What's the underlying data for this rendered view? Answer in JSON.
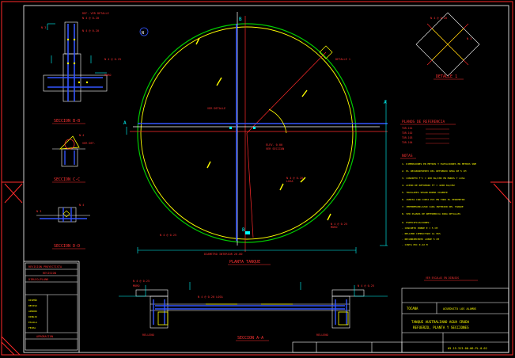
{
  "colors": {
    "background": "#000000",
    "border": "#ff2a2a",
    "frame": "#ffffff",
    "tank_outer": "#ffff00",
    "tank_inner": "#00cc00",
    "axis": "#ff2a2a",
    "rebar": "#3355ff",
    "cyan": "#00ffff",
    "magenta": "#ff00ff",
    "text_red": "#ff3333",
    "text_yellow": "#ffff00"
  },
  "labels": {
    "section_bb": "SECCION B-B",
    "section_cc": "SECCION C-C",
    "section_dd": "SECCION D-D",
    "plan_title": "PLANTA TANQUE",
    "detail_1": "DETALLE 1",
    "section_aa": "SECCION A-A",
    "planos_referencia": "PLANOS DE REFERENCIA",
    "notas": "NOTAS",
    "cut_a_left": "A",
    "cut_a_right": "A",
    "cut_b_top": "B",
    "cut_b_bottom": "B"
  },
  "notes": {
    "ref_lines": [
      "TOR-101",
      "TOR-102",
      "TOR-103",
      "TOR-104"
    ],
    "lines": [
      "1. DIMENSIONES EN METROS Y ELEVACIONES EN METROS SNM",
      "2. EL RECUBRIMIENTO DEL REFUERZO SERA DE 5 CM",
      "3. CONCRETO F'C = 280 KG/CM2 EN MUROS Y LOSA",
      "4. ACERO DE REFUERZO FY = 4200 KG/CM2",
      "5. TRASLAPES SEGUN NORMA VIGENTE",
      "6. JUNTAS CON CINTA PVC EN TODO EL PERIMETRO",
      "7. IMPERMEABILIZAR CARA INTERIOR DEL TANQUE",
      "8. VER PLANOS DE REFERENCIA PARA DETALLES",
      "9. ESPECIFICACIONES:",
      " - CONCRETO POBRE E = 5 CM",
      " - RELLENO COMPACTADO AL 95%",
      " - RECUBRIMIENTO LIBRE 5 CM",
      " - CINTA PVC 0.22 M"
    ]
  },
  "revision_box": {
    "title": "REVISION PROYECTISTA",
    "sub1": "REVISION",
    "sub2": "DIBUJO/PLANO",
    "aprobacion": "APROBACION",
    "items": [
      "DISEÑO",
      "REVISO",
      "APROBO",
      "DIBUJO",
      "ESCALA",
      "FECHA"
    ]
  },
  "title_block": {
    "scale_note": "VER ESCALAS EN DIBUJOS",
    "company": "TOCANA",
    "project": "ACUEDUCTO LOS ALAMOS",
    "title_line1": "TANQUE AUSTRALIANO AGUA CRUDA",
    "title_line2": "REFUERZO, PLANTA Y SECCIONES",
    "drawing_no": "05-15-313-00-06-PL-0-02"
  }
}
